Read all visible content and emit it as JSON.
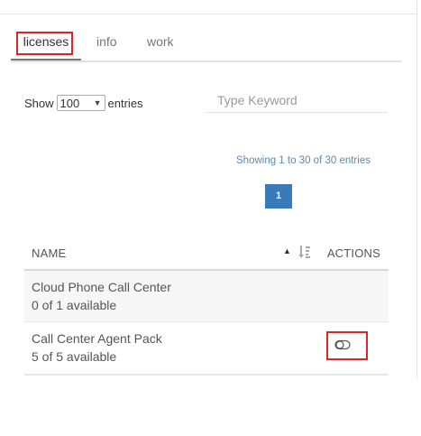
{
  "tabs": [
    {
      "label": "licenses",
      "active": true
    },
    {
      "label": "info",
      "active": false
    },
    {
      "label": "work",
      "active": false
    }
  ],
  "length_menu": {
    "prefix": "Show",
    "selected": "100",
    "suffix": "entries"
  },
  "search": {
    "placeholder": "Type Keyword",
    "value": ""
  },
  "info_text": "Showing 1 to 30 of 30 entries",
  "pagination": {
    "current_page": "1"
  },
  "table": {
    "columns": [
      "NAME",
      "ACTIONS"
    ],
    "sort_column": "NAME",
    "sort_direction": "ascending",
    "rows": [
      {
        "name": "Cloud Phone Call Center",
        "availability": "0 of 1 available",
        "action_icon": null
      },
      {
        "name": "Call Center Agent Pack",
        "availability": "5 of 5 available",
        "action_icon": "toggle-icon"
      }
    ]
  },
  "highlight_color": "#d8262b",
  "accent_color": "#3a7ab8"
}
